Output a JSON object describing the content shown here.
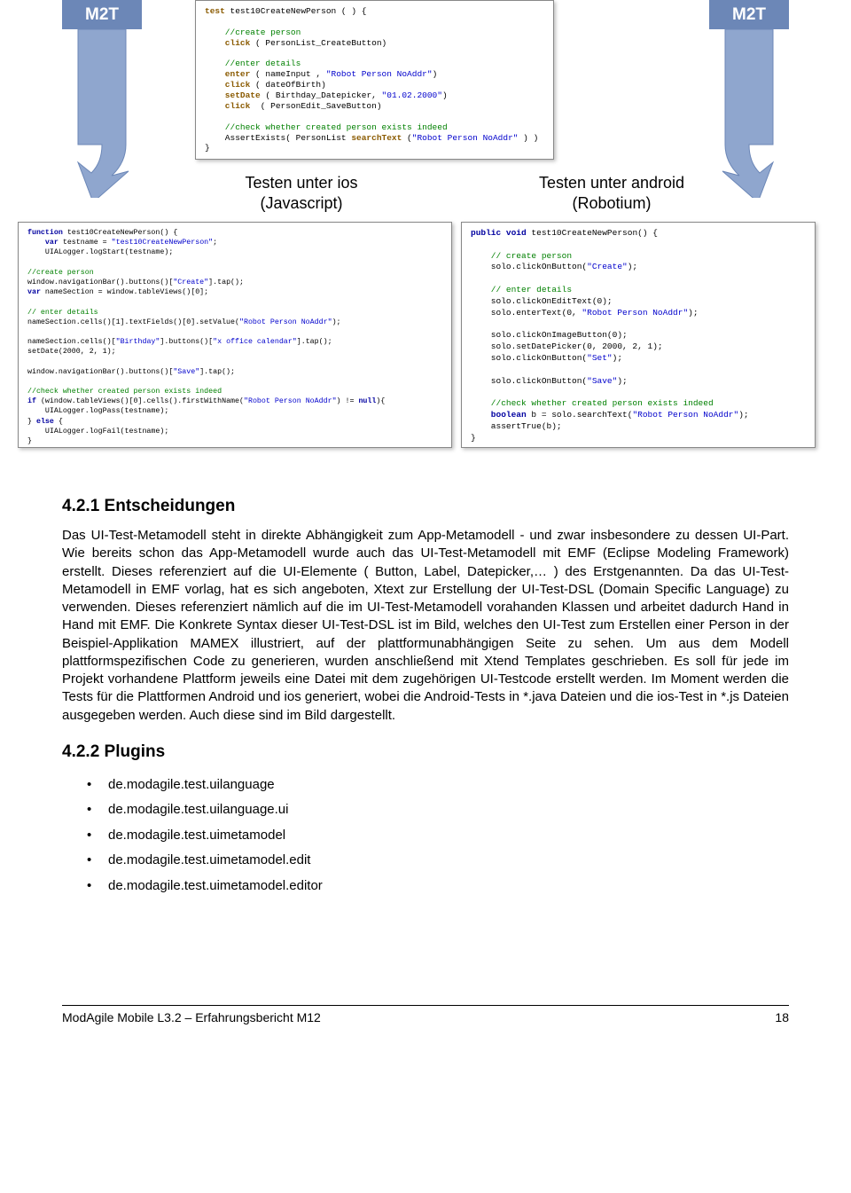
{
  "arrows": {
    "left_label": "M2T",
    "right_label": "M2T"
  },
  "platforms": {
    "ios_line1": "Testen unter ios",
    "ios_line2": "(Javascript)",
    "android_line1": "Testen unter android",
    "android_line2": "(Robotium)"
  },
  "top_code": {
    "l1a": "test",
    "l1b": " test10CreateNewPerson ( ) {",
    "l2": "",
    "l3": "    //create person",
    "l4a": "    click",
    "l4b": " ( PersonList_CreateButton)",
    "l5": "",
    "l6": "    //enter details",
    "l7a": "    enter",
    "l7b": " ( nameInput , ",
    "l7c": "\"Robot Person NoAddr\"",
    "l7d": ")",
    "l8a": "    click",
    "l8b": " ( dateOfBirth)",
    "l9a": "    setDate",
    "l9b": " ( Birthday_Datepicker, ",
    "l9c": "\"01.02.2000\"",
    "l9d": ")",
    "l10a": "    click",
    "l10b": "  ( PersonEdit_SaveButton)",
    "l11": "",
    "l12": "    //check whether created person exists indeed",
    "l13a": "    AssertExists( PersonList ",
    "l13b": "searchText",
    "l13c": " (",
    "l13d": "\"Robot Person NoAddr\"",
    "l13e": " ) )",
    "l14": "}"
  },
  "ios_code": {
    "l1a": "function",
    "l1b": " test10CreateNewPerson() {",
    "l2a": "    var",
    "l2b": " testname = ",
    "l2c": "\"test10CreateNewPerson\"",
    "l2d": ";",
    "l3": "    UIALogger.logStart(testname);",
    "l4": "",
    "l5": "//create person",
    "l6a": "window.navigationBar().buttons()[",
    "l6b": "\"Create\"",
    "l6c": "].tap();",
    "l7a": "var",
    "l7b": " nameSection = window.tableViews()[0];",
    "l8": "",
    "l9": "// enter details",
    "l10a": "nameSection.cells()[1].textFields()[0].setValue(",
    "l10b": "\"Robot Person NoAddr\"",
    "l10c": ");",
    "l11": "",
    "l12a": "nameSection.cells()[",
    "l12b": "\"Birthday\"",
    "l12c": "].buttons()[",
    "l12d": "\"x office calendar\"",
    "l12e": "].tap();",
    "l13": "setDate(2000, 2, 1);",
    "l14": "",
    "l15a": "window.navigationBar().buttons()[",
    "l15b": "\"Save\"",
    "l15c": "].tap();",
    "l16": "",
    "l17": "//check whether created person exists indeed",
    "l18a": "if",
    "l18b": " (window.tableViews()[0].cells().firstWithName(",
    "l18c": "\"Robot Person NoAddr\"",
    "l18d": ") != ",
    "l18e": "null",
    "l18f": "){",
    "l19": "    UIALogger.logPass(testname);",
    "l20a": "} ",
    "l20b": "else",
    "l20c": " {",
    "l21": "    UIALogger.logFail(testname);",
    "l22": "}",
    "l23": "}"
  },
  "android_code": {
    "l1a": "public void",
    "l1b": " test10CreateNewPerson() {",
    "l2": "",
    "l3": "    // create person",
    "l4a": "    solo.clickOnButton(",
    "l4b": "\"Create\"",
    "l4c": ");",
    "l5": "",
    "l6": "    // enter details",
    "l7": "    solo.clickOnEditText(0);",
    "l8a": "    solo.enterText(0, ",
    "l8b": "\"Robot Person NoAddr\"",
    "l8c": ");",
    "l9": "",
    "l10": "    solo.clickOnImageButton(0);",
    "l11": "    solo.setDatePicker(0, 2000, 2, 1);",
    "l12a": "    solo.clickOnButton(",
    "l12b": "\"Set\"",
    "l12c": ");",
    "l13": "",
    "l14a": "    solo.clickOnButton(",
    "l14b": "\"Save\"",
    "l14c": ");",
    "l15": "",
    "l16": "    //check whether created person exists indeed",
    "l17a": "    boolean",
    "l17b": " b = solo.searchText(",
    "l17c": "\"Robot Person NoAddr\"",
    "l17d": ");",
    "l18": "    assertTrue(b);",
    "l19": "}"
  },
  "section1_num": "4.2.1 Entscheidungen",
  "para1": "Das UI-Test-Metamodell steht in direkte Abhängigkeit zum App-Metamodell - und zwar insbesondere zu dessen UI-Part. Wie bereits schon das App-Metamodell wurde auch das UI-Test-Metamodell mit EMF (Eclipse Modeling Framework) erstellt. Dieses referenziert auf die UI-Elemente ( Button, Label, Datepicker,… ) des Erstgenannten. Da das UI-Test-Metamodell in EMF vorlag, hat es sich angeboten, Xtext zur Erstellung der UI-Test-DSL (Domain Specific Language) zu verwenden. Dieses referenziert nämlich auf die im UI-Test-Metamodell vorahanden Klassen und arbeitet dadurch Hand in Hand mit EMF. Die Konkrete Syntax dieser UI-Test-DSL ist im Bild, welches den UI-Test zum Erstellen einer Person in der Beispiel-Applikation MAMEX illustriert, auf der plattformunabhängigen Seite zu sehen. Um aus dem Modell plattformspezifischen Code zu generieren, wurden anschließend mit Xtend Templates geschrieben. Es soll für jede im Projekt vorhandene Plattform jeweils eine Datei mit dem zugehörigen UI-Testcode erstellt werden. Im Moment werden die Tests für die Plattformen Android und ios generiert, wobei die Android-Tests in *.java Dateien und die ios-Test in *.js Dateien ausgegeben werden. Auch diese sind im Bild dargestellt.",
  "section2_num": "4.2.2 Plugins",
  "plugins": [
    "de.modagile.test.uilanguage",
    "de.modagile.test.uilanguage.ui",
    "de.modagile.test.uimetamodel",
    "de.modagile.test.uimetamodel.edit",
    "de.modagile.test.uimetamodel.editor"
  ],
  "footer_left": "ModAgile Mobile L3.2 – Erfahrungsbericht M12",
  "footer_right": "18"
}
